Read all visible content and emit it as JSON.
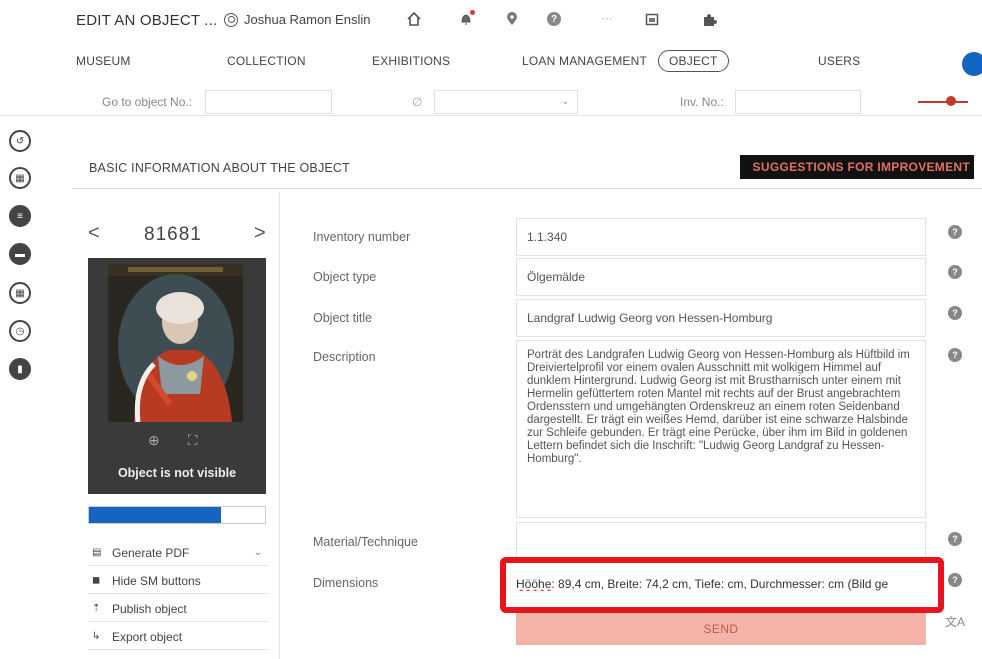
{
  "header": {
    "app_title": "EDIT AN OBJECT ...",
    "user_name": "Joshua Ramon Enslin",
    "icons": [
      "home-icon",
      "bell-icon",
      "location-icon",
      "help-icon",
      "more-icon",
      "calendar-icon",
      "puzzle-icon"
    ]
  },
  "nav": {
    "items": [
      "MUSEUM",
      "COLLECTION",
      "EXHIBITIONS",
      "LOAN MANAGEMENT",
      "OBJECT",
      "USERS"
    ],
    "active": "OBJECT"
  },
  "search": {
    "goto_label": "Go to object No.:",
    "goto_value": "",
    "empty_symbol": "∅",
    "select_value": "",
    "inv_label": "Inv. No.:",
    "inv_value": ""
  },
  "section": {
    "title": "BASIC INFORMATION ABOUT THE OBJECT",
    "suggest_label": "SUGGESTIONS FOR IMPROVEMENT"
  },
  "object": {
    "prev": "<",
    "number": "81681",
    "next": ">",
    "visibility_text": "Object is not visible",
    "progress_fraction": 0.75
  },
  "menu": {
    "items": [
      {
        "label": "Generate PDF",
        "icon": "pdf-icon",
        "has_chevron": true
      },
      {
        "label": "Hide SM buttons",
        "icon": "hide-icon",
        "has_chevron": false
      },
      {
        "label": "Publish object",
        "icon": "publish-icon",
        "has_chevron": false
      },
      {
        "label": "Export object",
        "icon": "export-icon",
        "has_chevron": false
      }
    ]
  },
  "form": {
    "inventory_label": "Inventory number",
    "inventory_value": "1.1.340",
    "type_label": "Object type",
    "type_value": "Ölgemälde",
    "title_label": "Object title",
    "title_value": "Landgraf Ludwig Georg von Hessen-Homburg",
    "description_label": "Description",
    "description_value": "Porträt des Landgrafen Ludwig Georg von Hessen-Homburg als Hüftbild im Dreiviertelprofil vor einem ovalen Ausschnitt mit wolkigem Himmel auf dunklem Hintergrund. Ludwig Georg ist mit Brustharnisch unter einem mit Hermelin gefüttertem roten Mantel mit rechts auf der Brust angebrachtem Ordensstern und umgehängten Ordenskreuz an einem roten Seidenband dargestellt. Er trägt ein weißes Hemd, darüber ist eine schwarze Halsbinde zur Schleife gebunden. Er trägt eine Perücke, über ihm im Bild in goldenen Lettern befindet sich die Inschrift: \"Ludwig Georg Landgraf zu Hessen-Homburg\".",
    "material_label": "Material/Technique",
    "material_value": "",
    "dimensions_label": "Dimensions",
    "dimensions_misspelled": "Hööhe",
    "dimensions_rest": ": 89,4 cm, Breite: 74,2 cm, Tiefe: cm, Durchmesser: cm (Bild ge",
    "send_label": "SEND",
    "help_symbol": "?"
  },
  "colors": {
    "accent_blue": "#1565c0",
    "highlight_red": "#e8141c",
    "send_bg": "#f4b3a8"
  }
}
